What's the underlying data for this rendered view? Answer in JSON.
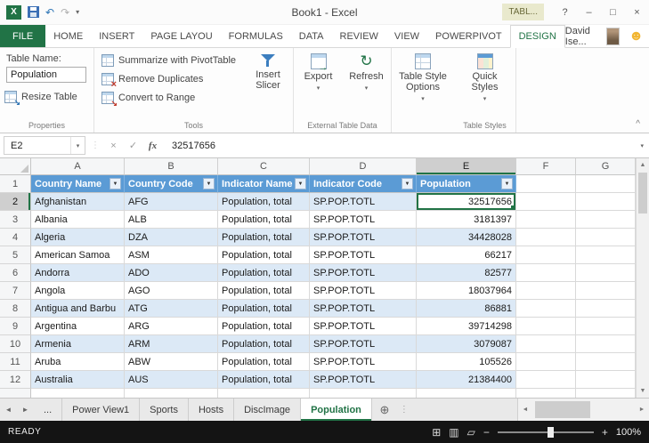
{
  "title_bar": {
    "title": "Book1 - Excel",
    "contextual_tab_label": "TABL..."
  },
  "ribbon": {
    "user_name": "David Ise...",
    "tabs": [
      {
        "label": "FILE",
        "file": true
      },
      {
        "label": "HOME"
      },
      {
        "label": "INSERT"
      },
      {
        "label": "PAGE LAYOU"
      },
      {
        "label": "FORMULAS"
      },
      {
        "label": "DATA"
      },
      {
        "label": "REVIEW"
      },
      {
        "label": "VIEW"
      },
      {
        "label": "POWERPIVOT"
      },
      {
        "label": "DESIGN",
        "active": true
      }
    ],
    "groups": {
      "properties": {
        "label": "Properties",
        "table_name_label": "Table Name:",
        "table_name_value": "Population",
        "resize_button_label": "Resize Table"
      },
      "tools": {
        "label": "Tools",
        "items": [
          {
            "label": "Summarize with PivotTable",
            "icon": "pivottable"
          },
          {
            "label": "Remove Duplicates",
            "icon": "remove-duplicates"
          },
          {
            "label": "Convert to Range",
            "icon": "convert-to-range"
          }
        ],
        "insert_slicer_label": "Insert Slicer"
      },
      "external_table_data": {
        "label": "External Table Data",
        "buttons": [
          {
            "label": "Export",
            "icon": "export"
          },
          {
            "label": "Refresh",
            "icon": "refresh"
          }
        ]
      },
      "table_style_options": {
        "button_label": "Table Style Options"
      },
      "table_styles": {
        "label": "Table Styles",
        "button_label": "Quick Styles"
      }
    }
  },
  "formula_bar": {
    "name_box": "E2",
    "fx_label": "fx",
    "value": "32517656"
  },
  "grid": {
    "column_headers": [
      "A",
      "B",
      "C",
      "D",
      "E",
      "F",
      "G"
    ],
    "selected_column": "E",
    "selected_cell": "E2",
    "table_header": [
      "Country Name",
      "Country Code",
      "Indicator Name",
      "Indicator Code",
      "Population"
    ],
    "rows": [
      {
        "n": 2,
        "selected": true,
        "cells": [
          "Afghanistan",
          "AFG",
          "Population, total",
          "SP.POP.TOTL",
          "32517656"
        ]
      },
      {
        "n": 3,
        "cells": [
          "Albania",
          "ALB",
          "Population, total",
          "SP.POP.TOTL",
          "3181397"
        ]
      },
      {
        "n": 4,
        "cells": [
          "Algeria",
          "DZA",
          "Population, total",
          "SP.POP.TOTL",
          "34428028"
        ]
      },
      {
        "n": 5,
        "cells": [
          "American Samoa",
          "ASM",
          "Population, total",
          "SP.POP.TOTL",
          "66217"
        ]
      },
      {
        "n": 6,
        "cells": [
          "Andorra",
          "ADO",
          "Population, total",
          "SP.POP.TOTL",
          "82577"
        ]
      },
      {
        "n": 7,
        "cells": [
          "Angola",
          "AGO",
          "Population, total",
          "SP.POP.TOTL",
          "18037964"
        ]
      },
      {
        "n": 8,
        "cells": [
          "Antigua and Barbu",
          "ATG",
          "Population, total",
          "SP.POP.TOTL",
          "86881"
        ]
      },
      {
        "n": 9,
        "cells": [
          "Argentina",
          "ARG",
          "Population, total",
          "SP.POP.TOTL",
          "39714298"
        ]
      },
      {
        "n": 10,
        "cells": [
          "Armenia",
          "ARM",
          "Population, total",
          "SP.POP.TOTL",
          "3079087"
        ]
      },
      {
        "n": 11,
        "cells": [
          "Aruba",
          "ABW",
          "Population, total",
          "SP.POP.TOTL",
          "105526"
        ]
      },
      {
        "n": 12,
        "cells": [
          "Australia",
          "AUS",
          "Population, total",
          "SP.POP.TOTL",
          "21384400"
        ]
      }
    ]
  },
  "sheet_tabs": {
    "tabs": [
      "...",
      "Power View1",
      "Sports",
      "Hosts",
      "DiscImage",
      "Population"
    ],
    "active": "Population"
  },
  "status_bar": {
    "mode": "READY",
    "zoom_level": "100%"
  },
  "colors": {
    "accent_green": "#217346",
    "table_header_blue": "#5B9BD5",
    "banded_row_blue": "#DCE9F6",
    "status_bar_bg": "#141414"
  },
  "icons": {
    "excel_logo": "X",
    "undo": "↶",
    "redo": "↷",
    "qat_dropdown": "▾",
    "help": "?",
    "minimize": "–",
    "maximize": "□",
    "close": "×",
    "smiley": "☻",
    "ribbon_collapse": "^",
    "name_box_dropdown": "▾",
    "separator_dots": "⋮",
    "cancel": "×",
    "enter": "✓",
    "formula_expand": "▾",
    "filter": "▼",
    "dropdown_small": "▾",
    "refresh_glyph": "↻",
    "scroll_up": "▲",
    "scroll_down": "▼",
    "scroll_left": "◄",
    "scroll_right": "►",
    "tab_nav_left": "◄",
    "tab_nav_right": "►",
    "add_sheet": "⊕",
    "tab_splitter": "⋮",
    "view_normal": "⊞",
    "view_page_layout": "▥",
    "view_page_break": "▱",
    "zoom_out": "−",
    "zoom_in": "+"
  }
}
